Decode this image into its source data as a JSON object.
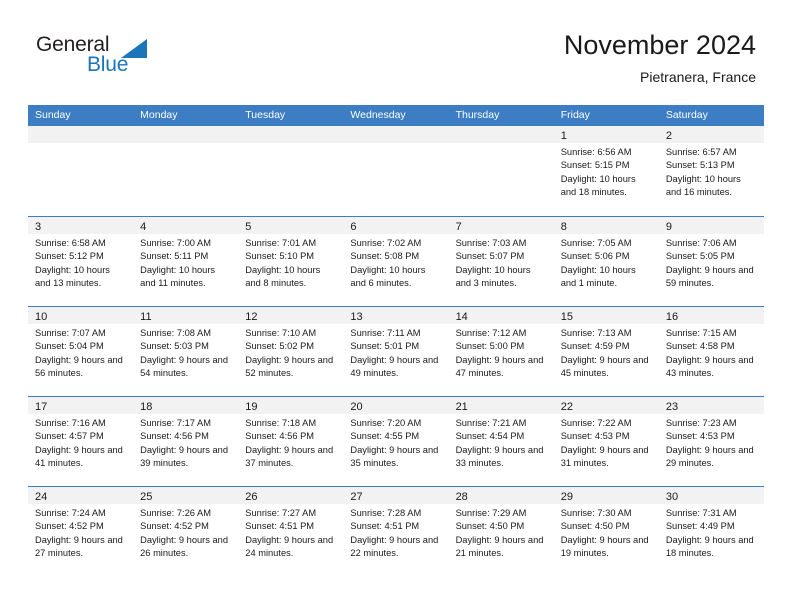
{
  "logo": {
    "word1": "General",
    "word2": "Blue",
    "triangle_color": "#1b75bb",
    "icon": "general-blue-logo"
  },
  "header": {
    "title": "November 2024",
    "subtitle": "Pietranera, France"
  },
  "colors": {
    "header_blue": "#3c7dc4",
    "day_band_gray": "#f2f2f2",
    "text": "#1a1a1a"
  },
  "weekdays": [
    "Sunday",
    "Monday",
    "Tuesday",
    "Wednesday",
    "Thursday",
    "Friday",
    "Saturday"
  ],
  "weeks": [
    [
      {
        "day": "",
        "empty": true
      },
      {
        "day": "",
        "empty": true
      },
      {
        "day": "",
        "empty": true
      },
      {
        "day": "",
        "empty": true
      },
      {
        "day": "",
        "empty": true
      },
      {
        "day": "1",
        "sunrise": "Sunrise: 6:56 AM",
        "sunset": "Sunset: 5:15 PM",
        "daylight": "Daylight: 10 hours and 18 minutes."
      },
      {
        "day": "2",
        "sunrise": "Sunrise: 6:57 AM",
        "sunset": "Sunset: 5:13 PM",
        "daylight": "Daylight: 10 hours and 16 minutes."
      }
    ],
    [
      {
        "day": "3",
        "sunrise": "Sunrise: 6:58 AM",
        "sunset": "Sunset: 5:12 PM",
        "daylight": "Daylight: 10 hours and 13 minutes."
      },
      {
        "day": "4",
        "sunrise": "Sunrise: 7:00 AM",
        "sunset": "Sunset: 5:11 PM",
        "daylight": "Daylight: 10 hours and 11 minutes."
      },
      {
        "day": "5",
        "sunrise": "Sunrise: 7:01 AM",
        "sunset": "Sunset: 5:10 PM",
        "daylight": "Daylight: 10 hours and 8 minutes."
      },
      {
        "day": "6",
        "sunrise": "Sunrise: 7:02 AM",
        "sunset": "Sunset: 5:08 PM",
        "daylight": "Daylight: 10 hours and 6 minutes."
      },
      {
        "day": "7",
        "sunrise": "Sunrise: 7:03 AM",
        "sunset": "Sunset: 5:07 PM",
        "daylight": "Daylight: 10 hours and 3 minutes."
      },
      {
        "day": "8",
        "sunrise": "Sunrise: 7:05 AM",
        "sunset": "Sunset: 5:06 PM",
        "daylight": "Daylight: 10 hours and 1 minute."
      },
      {
        "day": "9",
        "sunrise": "Sunrise: 7:06 AM",
        "sunset": "Sunset: 5:05 PM",
        "daylight": "Daylight: 9 hours and 59 minutes."
      }
    ],
    [
      {
        "day": "10",
        "sunrise": "Sunrise: 7:07 AM",
        "sunset": "Sunset: 5:04 PM",
        "daylight": "Daylight: 9 hours and 56 minutes."
      },
      {
        "day": "11",
        "sunrise": "Sunrise: 7:08 AM",
        "sunset": "Sunset: 5:03 PM",
        "daylight": "Daylight: 9 hours and 54 minutes."
      },
      {
        "day": "12",
        "sunrise": "Sunrise: 7:10 AM",
        "sunset": "Sunset: 5:02 PM",
        "daylight": "Daylight: 9 hours and 52 minutes."
      },
      {
        "day": "13",
        "sunrise": "Sunrise: 7:11 AM",
        "sunset": "Sunset: 5:01 PM",
        "daylight": "Daylight: 9 hours and 49 minutes."
      },
      {
        "day": "14",
        "sunrise": "Sunrise: 7:12 AM",
        "sunset": "Sunset: 5:00 PM",
        "daylight": "Daylight: 9 hours and 47 minutes."
      },
      {
        "day": "15",
        "sunrise": "Sunrise: 7:13 AM",
        "sunset": "Sunset: 4:59 PM",
        "daylight": "Daylight: 9 hours and 45 minutes."
      },
      {
        "day": "16",
        "sunrise": "Sunrise: 7:15 AM",
        "sunset": "Sunset: 4:58 PM",
        "daylight": "Daylight: 9 hours and 43 minutes."
      }
    ],
    [
      {
        "day": "17",
        "sunrise": "Sunrise: 7:16 AM",
        "sunset": "Sunset: 4:57 PM",
        "daylight": "Daylight: 9 hours and 41 minutes."
      },
      {
        "day": "18",
        "sunrise": "Sunrise: 7:17 AM",
        "sunset": "Sunset: 4:56 PM",
        "daylight": "Daylight: 9 hours and 39 minutes."
      },
      {
        "day": "19",
        "sunrise": "Sunrise: 7:18 AM",
        "sunset": "Sunset: 4:56 PM",
        "daylight": "Daylight: 9 hours and 37 minutes."
      },
      {
        "day": "20",
        "sunrise": "Sunrise: 7:20 AM",
        "sunset": "Sunset: 4:55 PM",
        "daylight": "Daylight: 9 hours and 35 minutes."
      },
      {
        "day": "21",
        "sunrise": "Sunrise: 7:21 AM",
        "sunset": "Sunset: 4:54 PM",
        "daylight": "Daylight: 9 hours and 33 minutes."
      },
      {
        "day": "22",
        "sunrise": "Sunrise: 7:22 AM",
        "sunset": "Sunset: 4:53 PM",
        "daylight": "Daylight: 9 hours and 31 minutes."
      },
      {
        "day": "23",
        "sunrise": "Sunrise: 7:23 AM",
        "sunset": "Sunset: 4:53 PM",
        "daylight": "Daylight: 9 hours and 29 minutes."
      }
    ],
    [
      {
        "day": "24",
        "sunrise": "Sunrise: 7:24 AM",
        "sunset": "Sunset: 4:52 PM",
        "daylight": "Daylight: 9 hours and 27 minutes."
      },
      {
        "day": "25",
        "sunrise": "Sunrise: 7:26 AM",
        "sunset": "Sunset: 4:52 PM",
        "daylight": "Daylight: 9 hours and 26 minutes."
      },
      {
        "day": "26",
        "sunrise": "Sunrise: 7:27 AM",
        "sunset": "Sunset: 4:51 PM",
        "daylight": "Daylight: 9 hours and 24 minutes."
      },
      {
        "day": "27",
        "sunrise": "Sunrise: 7:28 AM",
        "sunset": "Sunset: 4:51 PM",
        "daylight": "Daylight: 9 hours and 22 minutes."
      },
      {
        "day": "28",
        "sunrise": "Sunrise: 7:29 AM",
        "sunset": "Sunset: 4:50 PM",
        "daylight": "Daylight: 9 hours and 21 minutes."
      },
      {
        "day": "29",
        "sunrise": "Sunrise: 7:30 AM",
        "sunset": "Sunset: 4:50 PM",
        "daylight": "Daylight: 9 hours and 19 minutes."
      },
      {
        "day": "30",
        "sunrise": "Sunrise: 7:31 AM",
        "sunset": "Sunset: 4:49 PM",
        "daylight": "Daylight: 9 hours and 18 minutes."
      }
    ]
  ]
}
